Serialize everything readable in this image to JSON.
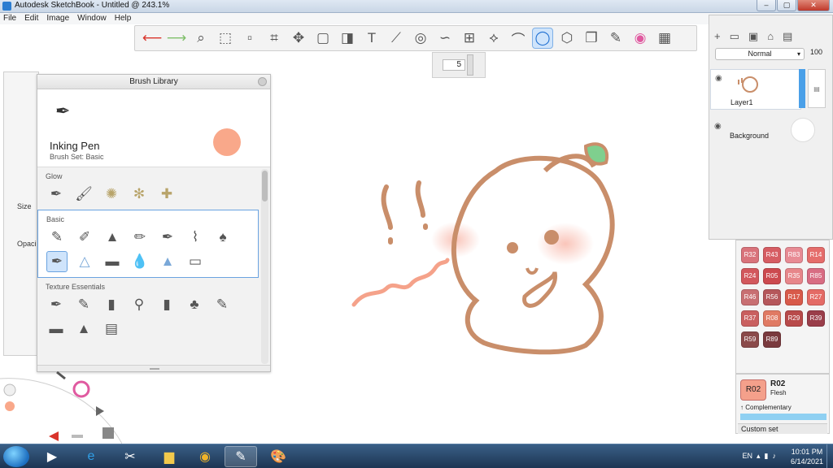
{
  "window": {
    "title": "Autodesk SketchBook - Untitled @ 243.1%",
    "minimize": "–",
    "maximize": "▢",
    "close": "✕"
  },
  "menu": [
    "File",
    "Edit",
    "Image",
    "Window",
    "Help"
  ],
  "toolbar": {
    "tools": [
      "undo-icon",
      "redo-icon",
      "zoom-icon",
      "select-rect-icon",
      "select-lasso-icon",
      "crop-icon",
      "transform-icon",
      "distort-icon",
      "fill-icon",
      "text-icon",
      "ruler-icon",
      "ellipse-guide-icon",
      "curve-guide-icon",
      "perspective-icon",
      "symmetry-icon",
      "stroke-icon",
      "circle-tool-icon",
      "shape-icon",
      "copy-paste-icon",
      "brush-palette-icon",
      "color-wheel-icon",
      "layer-editor-icon"
    ]
  },
  "size_popup": {
    "value": "5"
  },
  "brush_props": {
    "size_label": "Size",
    "opacity_label": "Opaci"
  },
  "brush_library": {
    "title": "Brush Library",
    "current": {
      "name": "Inking Pen",
      "set": "Brush Set: Basic",
      "color": "#f9a88a"
    },
    "sections": [
      {
        "title": "Glow"
      },
      {
        "title": "Basic"
      },
      {
        "title": "Texture Essentials"
      }
    ]
  },
  "layers": {
    "blend_mode": "Normal",
    "opacity": "100",
    "items": [
      {
        "name": "Layer1"
      },
      {
        "name": "Background"
      }
    ]
  },
  "swatches": [
    "R32",
    "R43",
    "R83",
    "R14",
    "R24",
    "R05",
    "R35",
    "R85",
    "R46",
    "R56",
    "R17",
    "R27",
    "R37",
    "R08",
    "R29",
    "R39",
    "R59",
    "R89"
  ],
  "swatch_colors": [
    "#d9737b",
    "#d65d63",
    "#e88b94",
    "#e56d6b",
    "#d2585d",
    "#cc4a4f",
    "#e7868a",
    "#d86d83",
    "#c86f72",
    "#b5575b",
    "#d85a4a",
    "#e46b66",
    "#c95f5f",
    "#e07a63",
    "#b84a4a",
    "#9a3e4a",
    "#8a4a4a",
    "#7a3a3e"
  ],
  "current_color": {
    "code": "R02",
    "name": "Flesh",
    "complementary": "Complementary",
    "custom_set": "Custom set"
  },
  "tray": {
    "lang": "EN",
    "time": "10:01 PM",
    "date": "6/14/2021"
  }
}
